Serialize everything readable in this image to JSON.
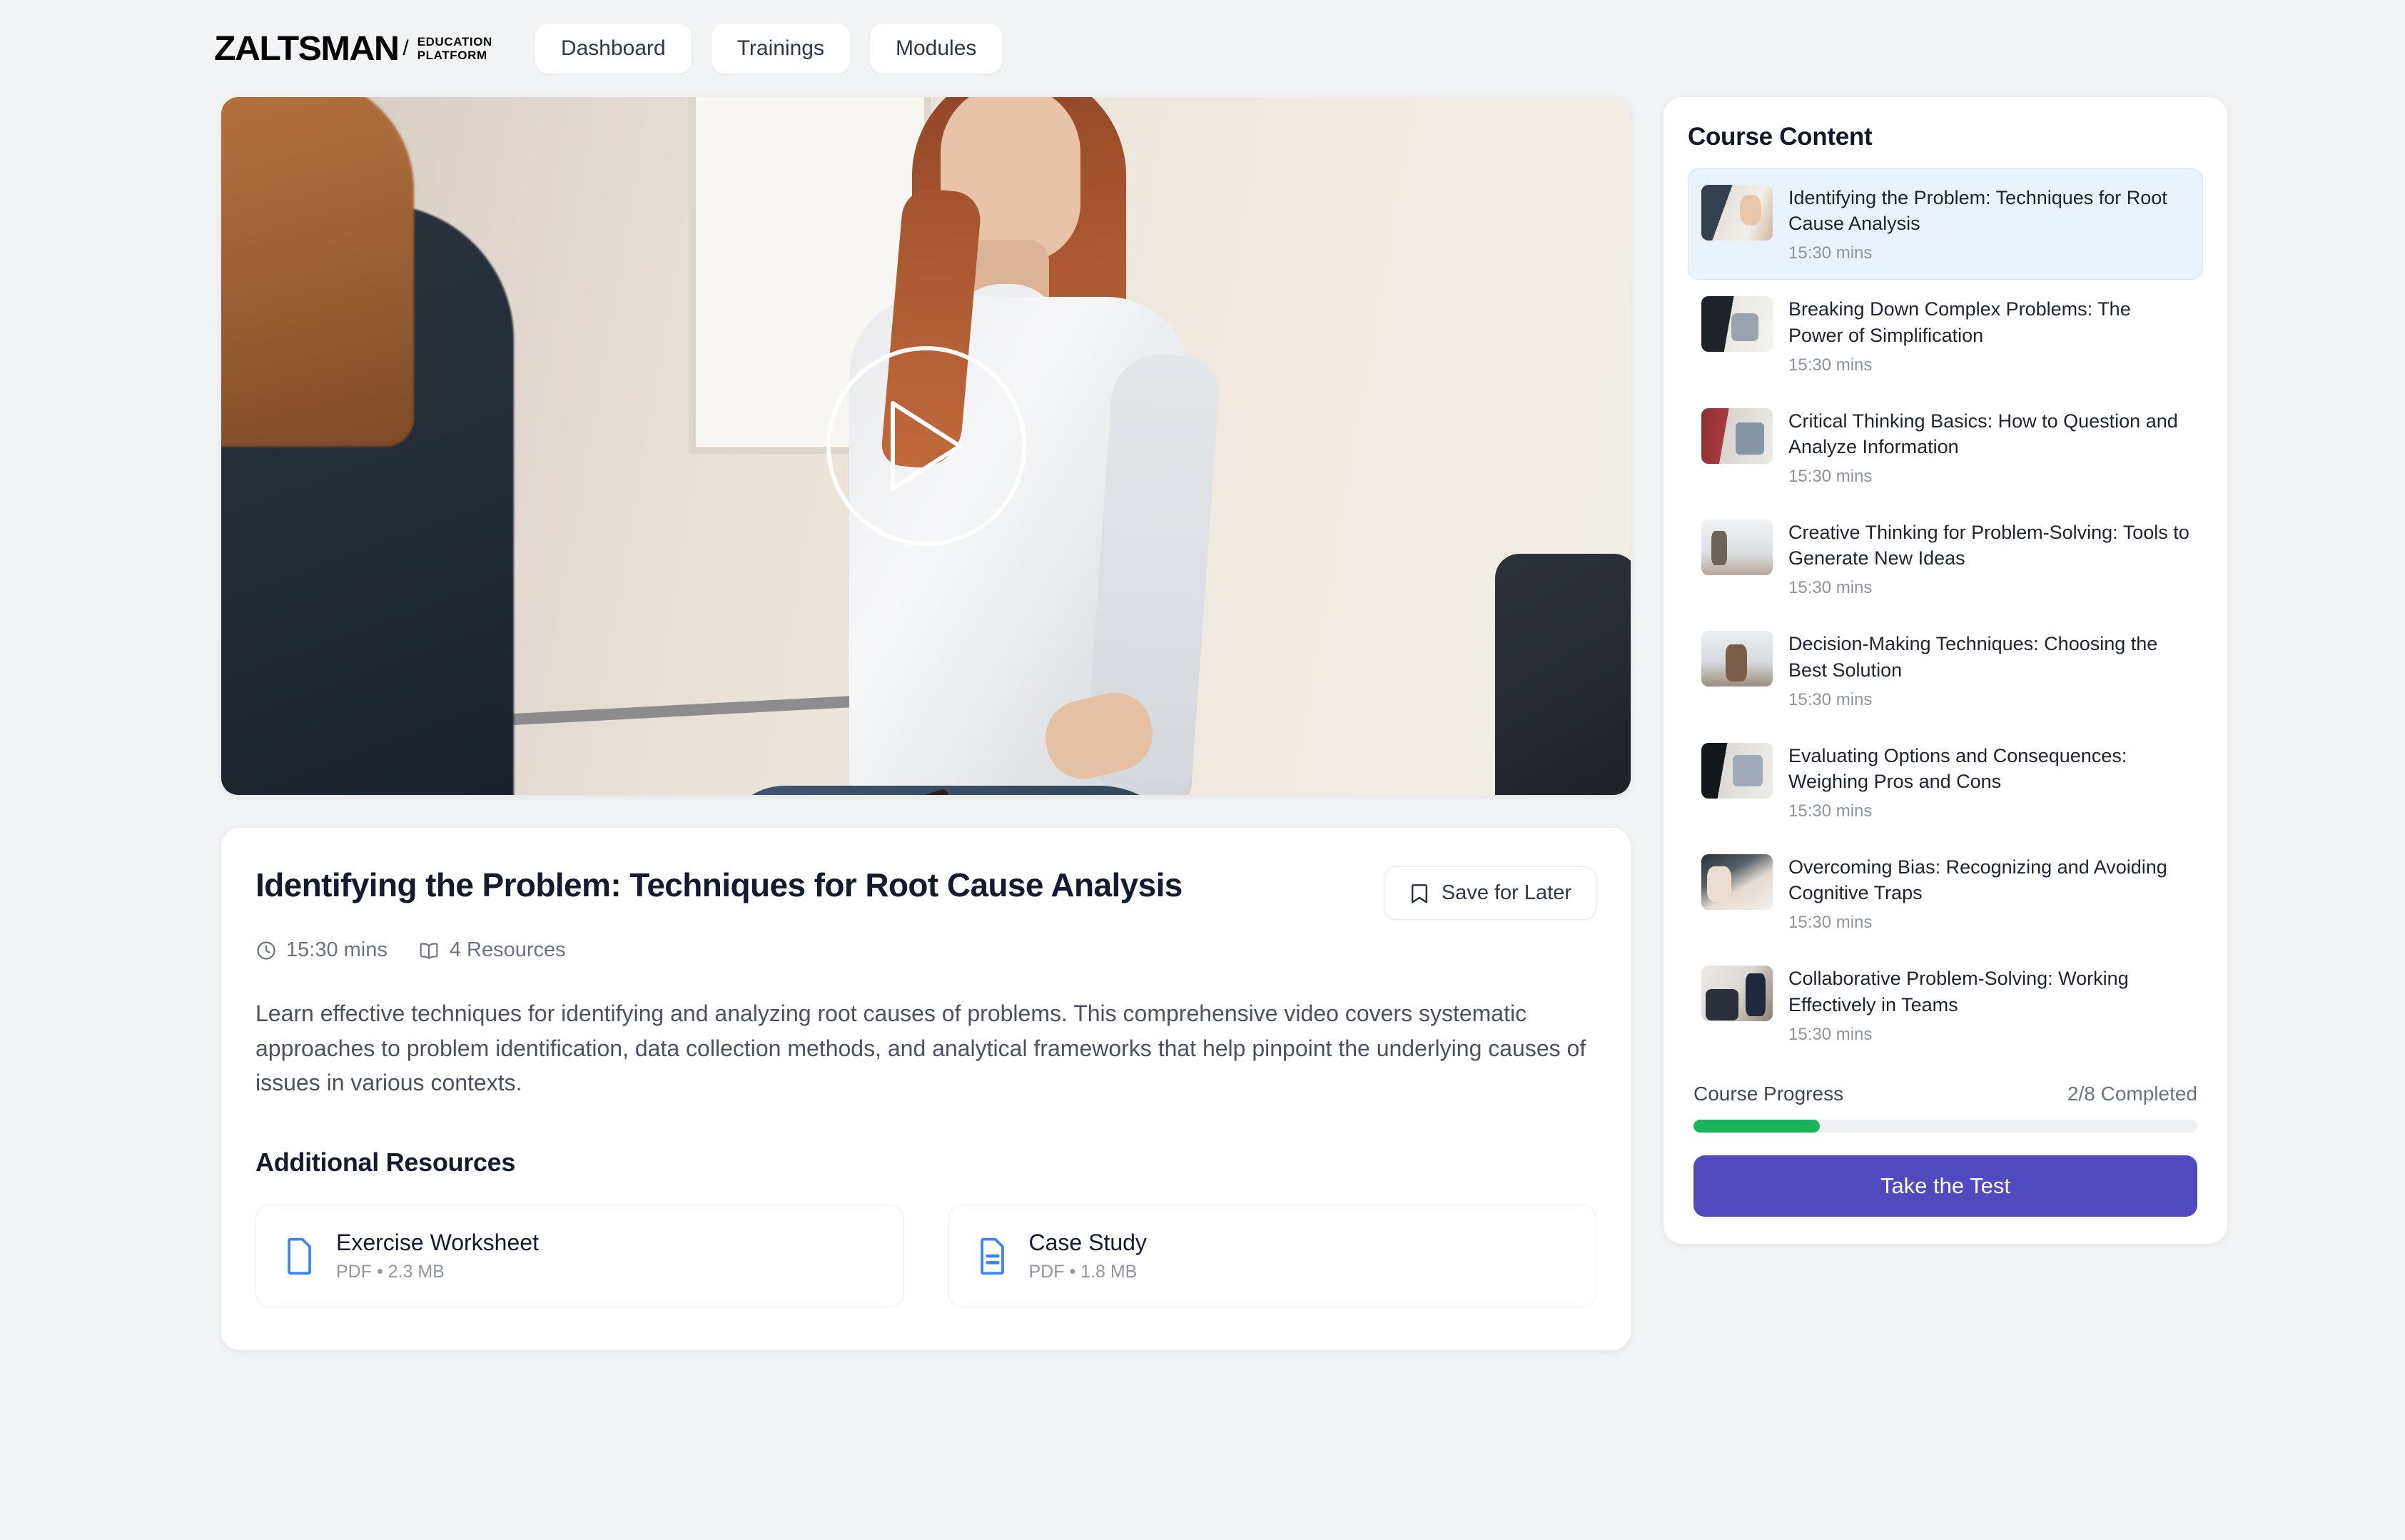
{
  "header": {
    "logo_word": "ZALTSMAN",
    "logo_slash": "/",
    "logo_sub_line1": "EDUCATION",
    "logo_sub_line2": "PLATFORM",
    "nav": [
      {
        "label": "Dashboard"
      },
      {
        "label": "Trainings"
      },
      {
        "label": "Modules"
      }
    ]
  },
  "video": {
    "play_label": "play-button"
  },
  "detail": {
    "title": "Identifying the Problem: Techniques for Root Cause Analysis",
    "save_label": "Save for Later",
    "duration": "15:30 mins",
    "resources_count": "4 Resources",
    "description": "Learn effective techniques for identifying and analyzing root causes of problems. This comprehensive video covers systematic approaches to problem identification, data collection methods, and analytical frameworks that help pinpoint the underlying causes of issues in various contexts.",
    "resources_heading": "Additional Resources",
    "resources": [
      {
        "name": "Exercise Worksheet",
        "meta": "PDF • 2.3 MB",
        "icon": "file-icon"
      },
      {
        "name": "Case Study",
        "meta": "PDF • 1.8 MB",
        "icon": "file-text-icon"
      }
    ]
  },
  "sidebar": {
    "title": "Course Content",
    "lessons": [
      {
        "title": "Identifying the Problem: Techniques for Root Cause Analysis",
        "duration": "15:30 mins",
        "active": true
      },
      {
        "title": "Breaking Down Complex Problems: The Power of Simplification",
        "duration": "15:30 mins",
        "active": false
      },
      {
        "title": "Critical Thinking Basics: How to Question and Analyze Information",
        "duration": "15:30 mins",
        "active": false
      },
      {
        "title": "Creative Thinking for Problem-Solving: Tools to Generate New Ideas",
        "duration": "15:30 mins",
        "active": false
      },
      {
        "title": "Decision-Making Techniques: Choosing the Best Solution",
        "duration": "15:30 mins",
        "active": false
      },
      {
        "title": "Evaluating Options and Consequences: Weighing Pros and Cons",
        "duration": "15:30 mins",
        "active": false
      },
      {
        "title": "Overcoming Bias: Recognizing and Avoiding Cognitive Traps",
        "duration": "15:30 mins",
        "active": false
      },
      {
        "title": "Collaborative Problem-Solving: Working Effectively in Teams",
        "duration": "15:30 mins",
        "active": false
      }
    ],
    "progress_label": "Course Progress",
    "progress_count": "2/8 Completed",
    "progress_percent": 25,
    "test_button": "Take the Test"
  },
  "colors": {
    "page_bg": "#f2f3f5",
    "card_bg": "#ffffff",
    "accent_purple": "#5248c0",
    "progress_green": "#19b55a",
    "active_item_bg": "#eaf2fd",
    "file_icon_blue": "#3b82f6"
  }
}
